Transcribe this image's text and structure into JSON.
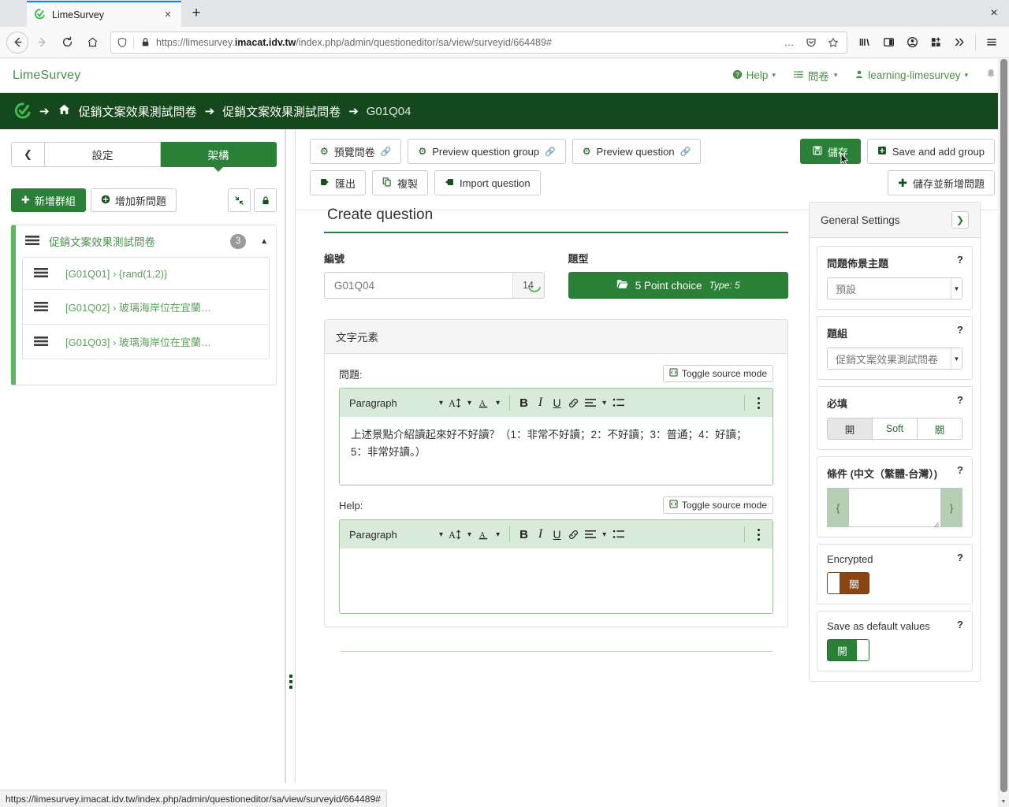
{
  "browser": {
    "tab": {
      "title": "LimeSurvey",
      "favicon": "limesurvey-logo-icon",
      "close": "×"
    },
    "newtab_label": "+",
    "window_close": "×",
    "nav": {
      "back": "←",
      "forward": "→",
      "reload": "⟳",
      "home": "⌂"
    },
    "url": {
      "prefix": "https://limesurvey.",
      "domain": "imacat.idv.tw",
      "path": "/index.php/admin/questioneditor/sa/view/surveyid/664489#",
      "full": "https://limesurvey.imacat.idv.tw/index.php/admin/questioneditor/sa/view/surveyid/664489#",
      "more_label": "…"
    },
    "toolbar_icons": [
      "library-icon",
      "sidebar-icon",
      "account-icon",
      "extensions-icon",
      "overflow-icon",
      "menu-icon"
    ]
  },
  "statusbar": {
    "url": "https://limesurvey.imacat.idv.tw/index.php/admin/questioneditor/sa/view/surveyid/664489#"
  },
  "topbar": {
    "brand": "LimeSurvey",
    "nav": [
      {
        "label": "Help",
        "icon": "help-circle-icon",
        "caret": "▾"
      },
      {
        "label": "問卷",
        "icon": "list-icon",
        "caret": "▾"
      },
      {
        "label": "learning-limesurvey",
        "icon": "user-icon",
        "caret": "▾"
      }
    ],
    "bell_icon": "notification-bell-icon"
  },
  "breadcrumb": {
    "arrow": "➔",
    "home_icon": "home-icon",
    "items": [
      "促銷文案效果測試問卷",
      "促銷文案效果測試問卷",
      "G01Q04"
    ]
  },
  "sidebar": {
    "collapse_icon": "chevron-left-icon",
    "tabs": [
      {
        "label": "設定",
        "active": false
      },
      {
        "label": "架構",
        "active": true
      }
    ],
    "add_group_label": "新增群組",
    "add_question_label": "增加新問題",
    "collapse_all_icon": "collapse-arrows-icon",
    "lock_icon": "lock-icon",
    "group": {
      "title": "促銷文案效果測試問卷",
      "count": "3",
      "caret": "▲",
      "questions": [
        {
          "label": "[G01Q01] › {rand(1,2)}"
        },
        {
          "label": "[G01Q02] › 玻璃海岸位在宜蘭…"
        },
        {
          "label": "[G01Q03] › 玻璃海岸位在宜蘭…"
        }
      ]
    }
  },
  "toolbar": {
    "row1": [
      {
        "label": "預覽問卷",
        "icon": "gear-icon",
        "external": true
      },
      {
        "label": "Preview question group",
        "icon": "gear-icon",
        "external": true
      },
      {
        "label": "Preview question",
        "icon": "gear-icon",
        "external": true
      }
    ],
    "row2": [
      {
        "label": "匯出",
        "icon": "export-icon",
        "external": false
      },
      {
        "label": "複製",
        "icon": "copy-icon",
        "external": false
      },
      {
        "label": "Import question",
        "icon": "import-icon",
        "external": false
      }
    ],
    "save_label": "儲存",
    "save_icon": "floppy-save-icon",
    "save_add_group_label": "Save and add group",
    "save_add_group_icon": "plus-square-icon",
    "save_add_question_label": "儲存並新增問題",
    "save_add_question_icon": "plus-icon"
  },
  "main": {
    "page_title": "Create question",
    "code": {
      "label": "編號",
      "value": "G01Q04",
      "counter": "14"
    },
    "qtype": {
      "label": "題型",
      "icon": "folder-open-icon",
      "value": "5 Point choice",
      "type_prefix": "Type:",
      "type_value": "5"
    },
    "text_panel": {
      "title": "文字元素",
      "question": {
        "label": "問題:",
        "toggle_source_label": "Toggle source mode",
        "toggle_source_icon": "source-code-icon",
        "body": "上述景點介紹讀起來好不好讀？（1：非常不好讀；2：不好讀；3：普通；4：好讀；5：非常好讀。）"
      },
      "help": {
        "label": "Help:",
        "toggle_source_label": "Toggle source mode",
        "toggle_source_icon": "source-code-icon",
        "body": ""
      },
      "editor_toolbar": {
        "paragraph": "Paragraph",
        "caret": "⌄",
        "font_size_icon": "font-size-icon",
        "text_color_icon": "text-color-icon",
        "bold": "B",
        "italic": "I",
        "underline": "U",
        "link_icon": "link-icon",
        "align_icon": "align-icon",
        "list_icon": "bullet-list-icon",
        "kebab_icon": "more-vertical-icon"
      }
    }
  },
  "settings": {
    "header": "General Settings",
    "expand_icon": "chevron-right-icon",
    "help_marker": "?",
    "cards": [
      {
        "name": "question-theme",
        "title": "問題佈景主題",
        "kind": "select",
        "value": "預設"
      },
      {
        "name": "question-group",
        "title": "題組",
        "kind": "select",
        "value": "促銷文案效果測試問卷"
      },
      {
        "name": "mandatory",
        "title": "必填",
        "kind": "buttons3",
        "options": [
          "開",
          "Soft",
          "關"
        ],
        "selected": 0
      },
      {
        "name": "relevance",
        "title": "條件 (中文（繁體-台灣）)",
        "kind": "relevance",
        "left_brace": "{",
        "right_brace": "}",
        "value": ""
      },
      {
        "name": "encrypted",
        "title": "Encrypted",
        "kind": "toggle",
        "state": "off",
        "state_label": "關"
      },
      {
        "name": "save-default-values",
        "title": "Save as default values",
        "kind": "toggle",
        "state": "on",
        "state_label": "開"
      }
    ]
  }
}
